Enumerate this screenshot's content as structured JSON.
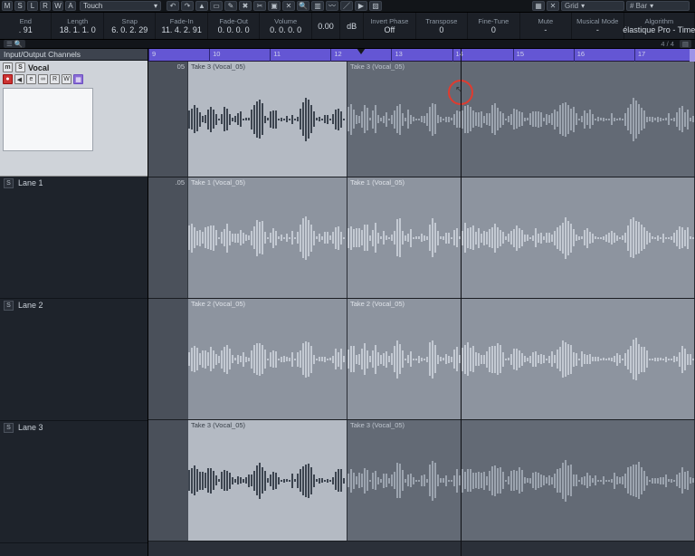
{
  "topStrip": {
    "btns": [
      "M",
      "S",
      "L",
      "R",
      "W",
      "A"
    ],
    "automationMode": "Touch",
    "gridLabel": "Grid",
    "barSelect": "# Bar"
  },
  "paramRow": [
    {
      "label": "End",
      "value": ". 91"
    },
    {
      "label": "Length",
      "value": "18. 1. 1. 0"
    },
    {
      "label": "Snap",
      "value": "6. 0. 2. 29"
    },
    {
      "label": "Fade-In",
      "value": "11. 4. 2. 91"
    },
    {
      "label": "Fade-Out",
      "value": "0. 0. 0. 0"
    },
    {
      "label": "Volume",
      "value": "0. 0. 0. 0"
    },
    {
      "label": "",
      "value": "0.00"
    },
    {
      "label": "",
      "value": "dB"
    },
    {
      "label": "Invert Phase",
      "value": "Off"
    },
    {
      "label": "Transpose",
      "value": "0"
    },
    {
      "label": "Fine-Tune",
      "value": "0"
    },
    {
      "label": "Mute",
      "value": "-"
    },
    {
      "label": "Musical Mode",
      "value": "-"
    },
    {
      "label": "Algorithm",
      "value": "élastique Pro - Time"
    }
  ],
  "filterRow": {
    "counter": "4 / 4"
  },
  "sidebar": {
    "head": "Input/Output Channels",
    "vocal": {
      "name": "Vocal",
      "tools1": [
        "m",
        "S"
      ],
      "tools2": [
        "●",
        "◀",
        "e",
        "∞",
        "R",
        "W",
        "▦"
      ]
    },
    "lanes": [
      "Lane 1",
      "Lane 2",
      "Lane 3"
    ],
    "laneSolo": "S"
  },
  "timeline": {
    "bars": [
      "9",
      "10",
      "11",
      "12",
      "13",
      "14",
      "15",
      "16",
      "17"
    ]
  },
  "clips": {
    "lane0_thin": "05",
    "lane1_thin": ".05",
    "label": "Take 3 (Vocal_05)",
    "take1": "Take 1 (Vocal_05)",
    "take2": "Take 2 (Vocal_05)",
    "take3": "Take 3 (Vocal_05)"
  }
}
